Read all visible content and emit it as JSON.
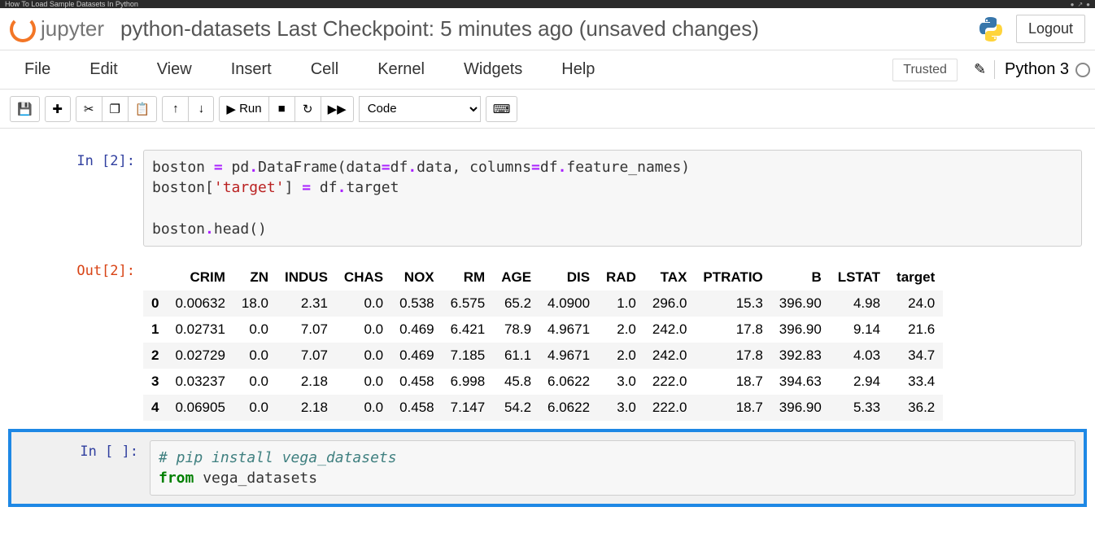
{
  "browser": {
    "tab_title": "How To Load Sample Datasets In Python"
  },
  "header": {
    "logo_text": "jupyter",
    "title": "python-datasets Last Checkpoint: 5 minutes ago  (unsaved changes)",
    "logout": "Logout"
  },
  "menubar": {
    "items": [
      "File",
      "Edit",
      "View",
      "Insert",
      "Cell",
      "Kernel",
      "Widgets",
      "Help"
    ],
    "trusted": "Trusted",
    "kernel": "Python 3"
  },
  "toolbar": {
    "run_label": "Run",
    "celltype": "Code"
  },
  "cells": [
    {
      "in_label": "In [2]:",
      "code_tokens": [
        {
          "t": "boston ",
          "c": ""
        },
        {
          "t": "=",
          "c": "tok-op"
        },
        {
          "t": " pd",
          "c": ""
        },
        {
          "t": ".",
          "c": "tok-op"
        },
        {
          "t": "DataFrame(data",
          "c": ""
        },
        {
          "t": "=",
          "c": "tok-op"
        },
        {
          "t": "df",
          "c": ""
        },
        {
          "t": ".",
          "c": "tok-op"
        },
        {
          "t": "data, columns",
          "c": ""
        },
        {
          "t": "=",
          "c": "tok-op"
        },
        {
          "t": "df",
          "c": ""
        },
        {
          "t": ".",
          "c": "tok-op"
        },
        {
          "t": "feature_names)\n",
          "c": ""
        },
        {
          "t": "boston[",
          "c": ""
        },
        {
          "t": "'target'",
          "c": "tok-str"
        },
        {
          "t": "] ",
          "c": ""
        },
        {
          "t": "=",
          "c": "tok-op"
        },
        {
          "t": " df",
          "c": ""
        },
        {
          "t": ".",
          "c": "tok-op"
        },
        {
          "t": "target\n\n",
          "c": ""
        },
        {
          "t": "boston",
          "c": ""
        },
        {
          "t": ".",
          "c": "tok-op"
        },
        {
          "t": "head()",
          "c": ""
        }
      ],
      "out_label": "Out[2]:",
      "table": {
        "columns": [
          "CRIM",
          "ZN",
          "INDUS",
          "CHAS",
          "NOX",
          "RM",
          "AGE",
          "DIS",
          "RAD",
          "TAX",
          "PTRATIO",
          "B",
          "LSTAT",
          "target"
        ],
        "index": [
          "0",
          "1",
          "2",
          "3",
          "4"
        ],
        "rows": [
          [
            "0.00632",
            "18.0",
            "2.31",
            "0.0",
            "0.538",
            "6.575",
            "65.2",
            "4.0900",
            "1.0",
            "296.0",
            "15.3",
            "396.90",
            "4.98",
            "24.0"
          ],
          [
            "0.02731",
            "0.0",
            "7.07",
            "0.0",
            "0.469",
            "6.421",
            "78.9",
            "4.9671",
            "2.0",
            "242.0",
            "17.8",
            "396.90",
            "9.14",
            "21.6"
          ],
          [
            "0.02729",
            "0.0",
            "7.07",
            "0.0",
            "0.469",
            "7.185",
            "61.1",
            "4.9671",
            "2.0",
            "242.0",
            "17.8",
            "392.83",
            "4.03",
            "34.7"
          ],
          [
            "0.03237",
            "0.0",
            "2.18",
            "0.0",
            "0.458",
            "6.998",
            "45.8",
            "6.0622",
            "3.0",
            "222.0",
            "18.7",
            "394.63",
            "2.94",
            "33.4"
          ],
          [
            "0.06905",
            "0.0",
            "2.18",
            "0.0",
            "0.458",
            "7.147",
            "54.2",
            "6.0622",
            "3.0",
            "222.0",
            "18.7",
            "396.90",
            "5.33",
            "36.2"
          ]
        ]
      }
    },
    {
      "in_label": "In [ ]:",
      "code_tokens": [
        {
          "t": "# pip install vega_datasets\n",
          "c": "tok-cmt"
        },
        {
          "t": "from",
          "c": "tok-kw"
        },
        {
          "t": " vega_datasets",
          "c": ""
        }
      ]
    }
  ]
}
